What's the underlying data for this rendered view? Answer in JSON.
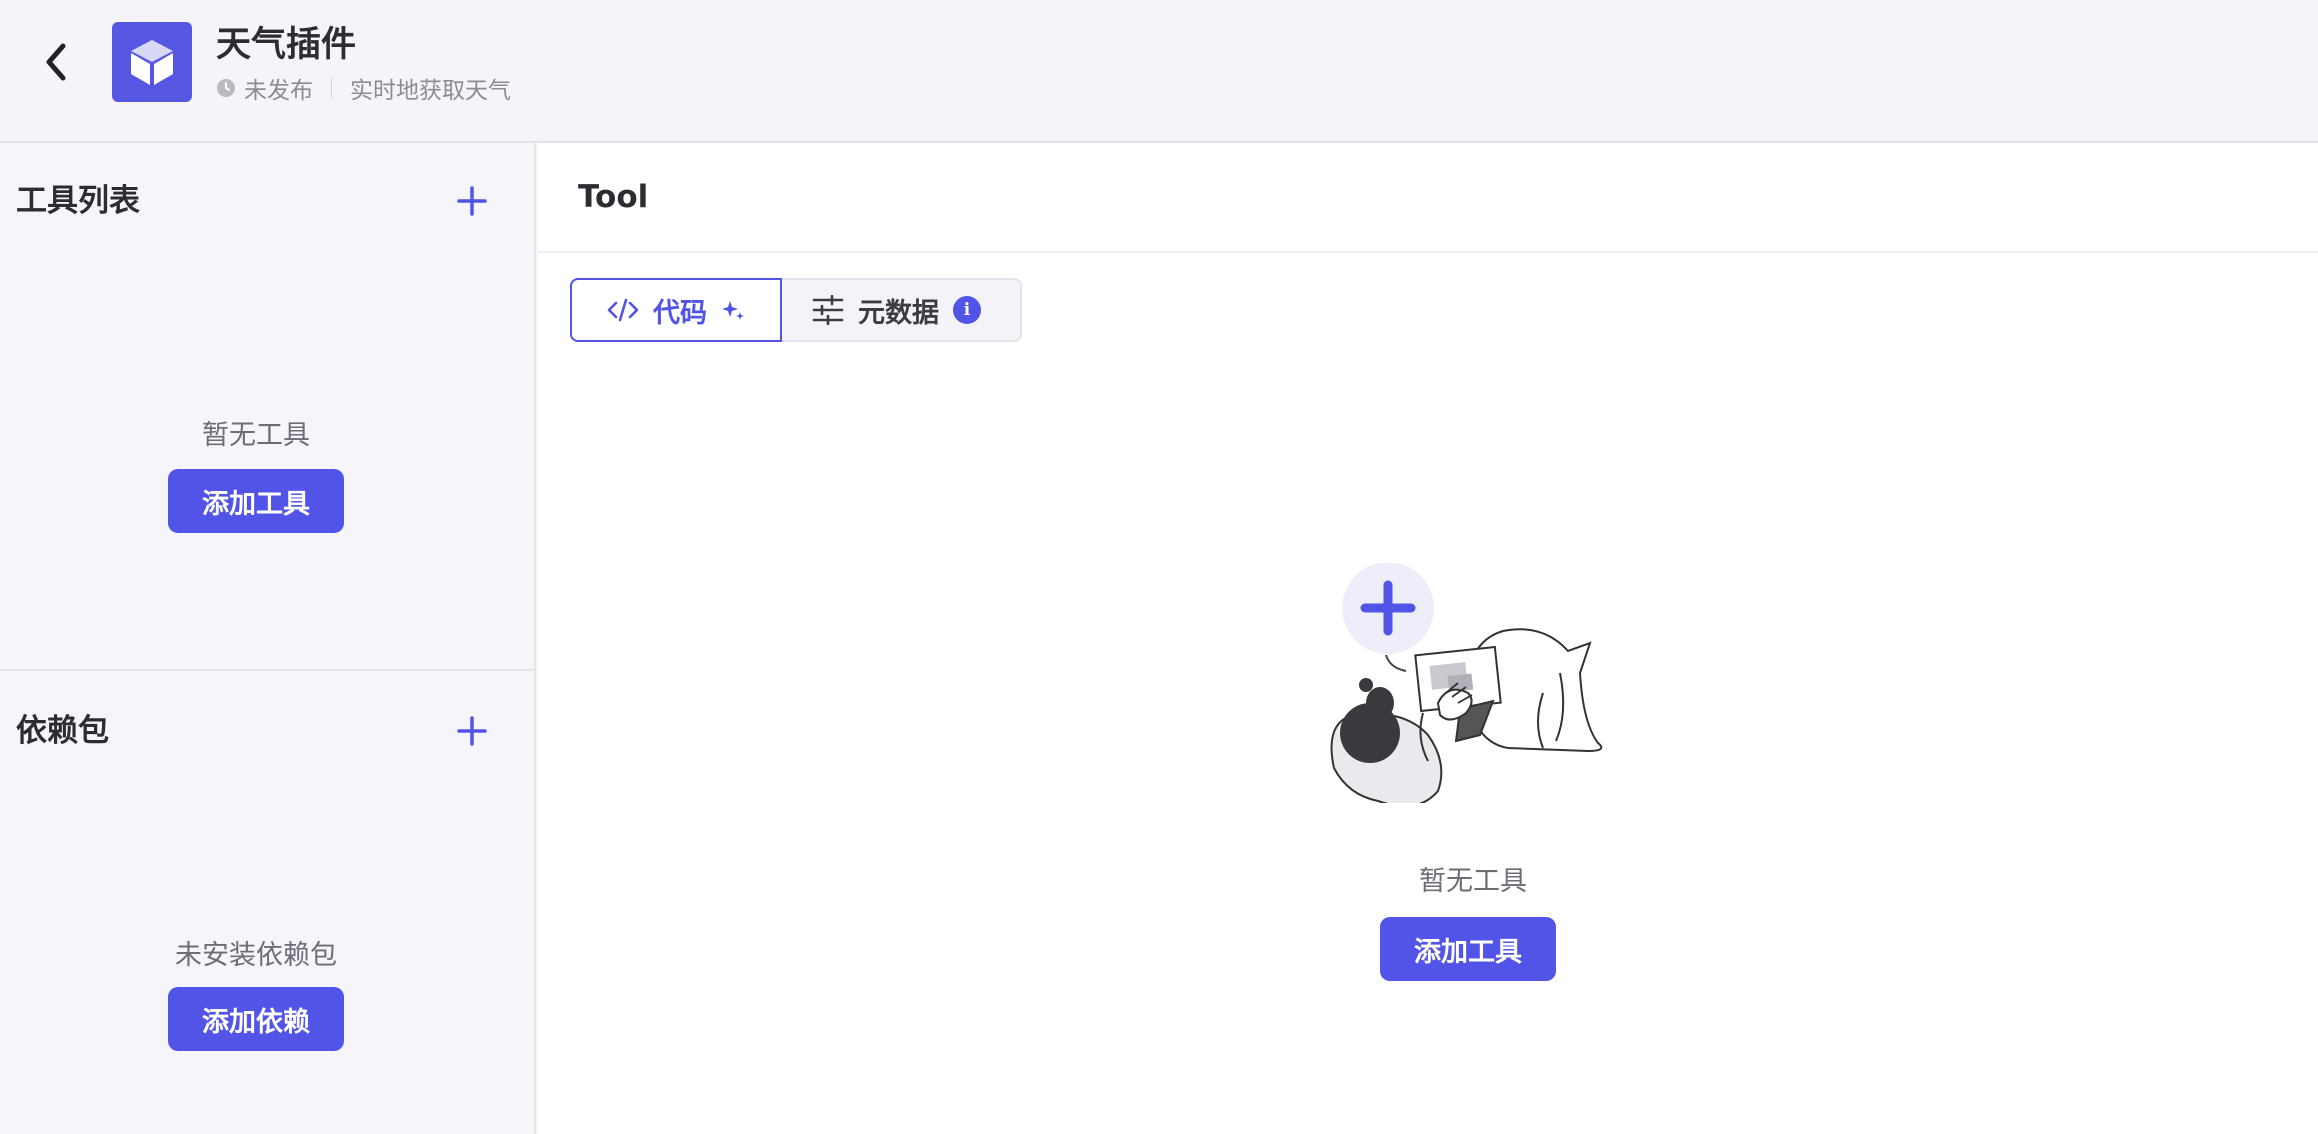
{
  "header": {
    "back_icon": "chevron-left-icon",
    "logo_icon": "cube-icon",
    "title": "天气插件",
    "status_icon": "clock-icon",
    "status": "未发布",
    "description": "实时地获取天气"
  },
  "sidebar": {
    "tools": {
      "title": "工具列表",
      "add_icon": "plus-icon",
      "empty_text": "暂无工具",
      "button_label": "添加工具"
    },
    "deps": {
      "title": "依赖包",
      "add_icon": "plus-icon",
      "empty_text": "未安装依赖包",
      "button_label": "添加依赖"
    }
  },
  "main": {
    "title": "Tool",
    "tabs": [
      {
        "label": "代码",
        "icon": "code-icon",
        "badge_icon": "sparkle-icon",
        "active": true
      },
      {
        "label": "元数据",
        "icon": "sliders-icon",
        "badge": "i",
        "active": false
      }
    ],
    "empty_text": "暂无工具",
    "button_label": "添加工具",
    "illustration": "person-with-laptop-illustration"
  },
  "colors": {
    "accent": "#5154e6",
    "background": "#f5f5fa",
    "panel": "#ffffff",
    "muted_text": "#6b6e76"
  }
}
